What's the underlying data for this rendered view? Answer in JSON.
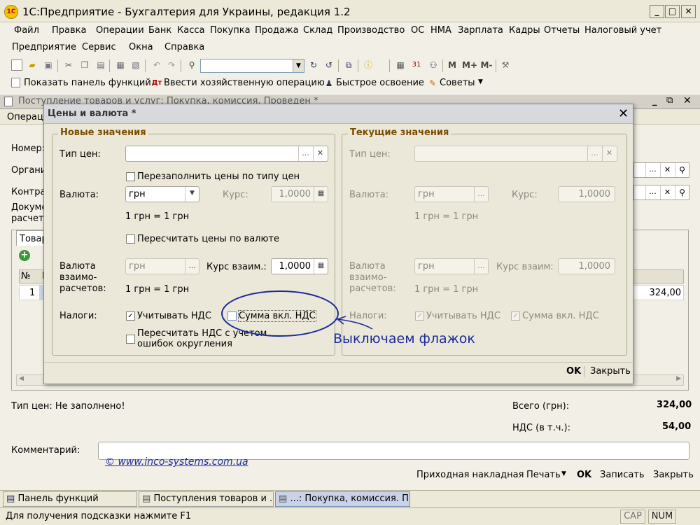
{
  "window": {
    "title": "1С:Предприятие - Бухгалтерия для Украины, редакция 1.2",
    "logo": "1С"
  },
  "menu": [
    "Файл",
    "Правка",
    "Операции",
    "Банк",
    "Касса",
    "Покупка",
    "Продажа",
    "Склад",
    "Производство",
    "ОС",
    "НМА",
    "Зарплата",
    "Кадры",
    "Отчеты",
    "Налоговый учет",
    "Предприятие",
    "Сервис",
    "Окна",
    "Справка"
  ],
  "toolbar2": {
    "show_panel": "Показать панель функций",
    "enter_op": "Ввести хозяйственную операцию",
    "quick": "Быстрое освоение",
    "tips": "Советы"
  },
  "document": {
    "title": "Поступление товаров и услуг: Покупка, комиссия. Проведен *",
    "ops_label": "Операц",
    "nomer_label": "Номер:",
    "org_label": "Органи",
    "contr_label": "Контра",
    "doc_label1": "Докуме",
    "doc_label2": "расчет",
    "tab_label": "Товар",
    "col_n": "№",
    "col_h": "Н",
    "row_n": "1",
    "row_sum": "324,00",
    "price_type_text": "Тип цен: Не заполнено!",
    "total_label": "Всего (грн):",
    "total_value": "324,00",
    "vat_label": "НДС (в т.ч.):",
    "vat_value": "54,00",
    "comment_label": "Комментарий:",
    "watermark": "© www.inco-systems.com.ua",
    "buttons": {
      "invoice": "Приходная накладная",
      "print": "Печать",
      "ok": "OK",
      "save": "Записать",
      "close": "Закрыть"
    }
  },
  "dialog": {
    "title": "Цены и валюта *",
    "new_group": "Новые значения",
    "current_group": "Текущие значения",
    "price_type_label": "Тип цен:",
    "refill_label": "Перезаполнить цены по типу цен",
    "currency_label": "Валюта:",
    "currency_value": "грн",
    "rate_label": "Курс:",
    "rate_value": "1,0000",
    "ratio_text": "1 грн = 1 грн",
    "recalc_label": "Пересчитать цены по валюте",
    "settle_label": [
      "Валюта",
      "взаимо-",
      "расчетов:"
    ],
    "settle_value": "грн",
    "settle_rate_label": "Курс взаим.:",
    "settle_rate_value": "1,0000",
    "cur_settle_rate_label": "Курс взаим:",
    "taxes_label": "Налоги:",
    "vat_check_label": "Учитывать НДС",
    "vat_incl_label": "Сумма вкл. НДС",
    "recalc_vat_label": "Пересчитать НДС с учетом ошибок округления",
    "ok": "OK",
    "close": "Закрыть"
  },
  "annotation": "Выключаем флажок",
  "taskbar": [
    "Панель функций",
    "Поступления товаров и ...",
    "...: Покупка, комиссия. Пр..."
  ],
  "statusbar": {
    "hint": "Для получения подсказки нажмите F1",
    "cap": "CAP",
    "num": "NUM"
  },
  "colors": {
    "annotation": "#1a2a9a",
    "group_title": "#7a4d00",
    "selected_tab": "#c9d3e8"
  }
}
